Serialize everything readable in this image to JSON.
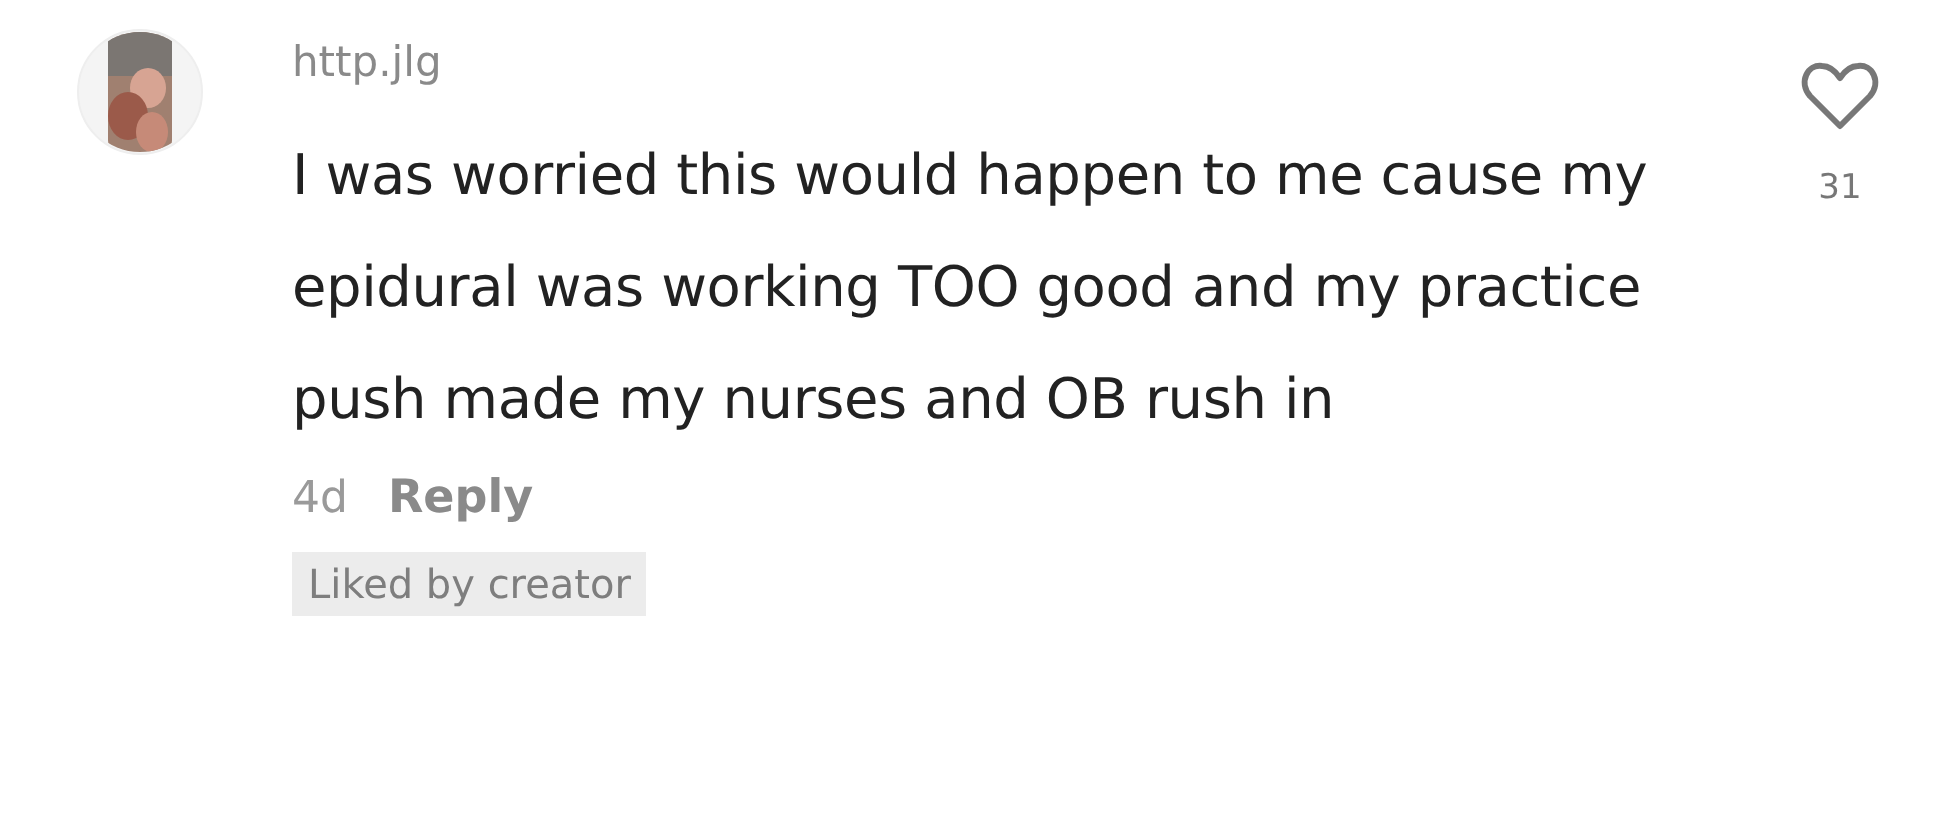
{
  "comment": {
    "username": "http.jlg",
    "text": "I was worried this would happen to me cause my epidural was working TOO good and my practice push made my nurses and OB rush in",
    "age": "4d",
    "reply": "Reply",
    "badge": "Liked by creator",
    "liked": false,
    "like_count": "31"
  }
}
